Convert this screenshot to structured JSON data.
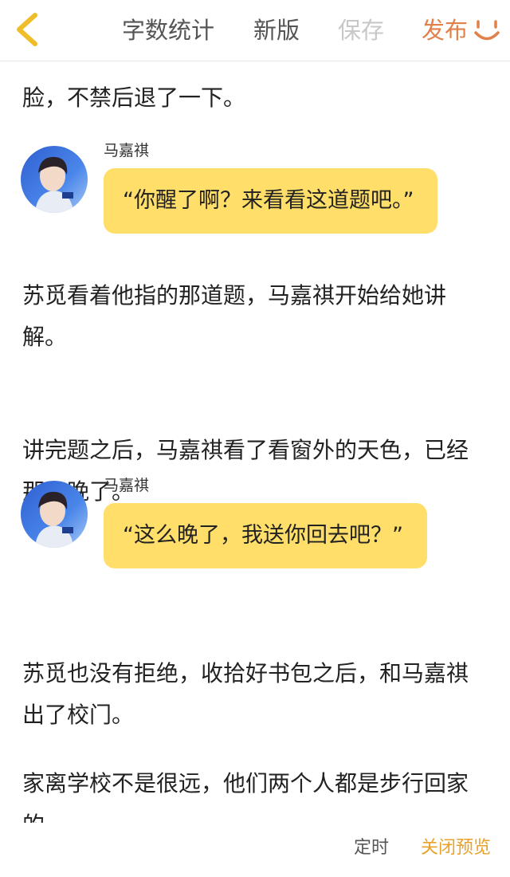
{
  "header": {
    "back_icon": "chevron-left-icon",
    "word_count": "字数统计",
    "new_version": "新版",
    "save": "保存",
    "publish": "发布",
    "emoji_icon": "smile-icon",
    "colors": {
      "accent_publish": "#e2804a",
      "disabled": "#c8c8c8"
    }
  },
  "story": {
    "cut_line": "脸，不禁后退了一下。",
    "messages": [
      {
        "speaker": "马嘉祺",
        "text": "“你醒了啊？来看看这道题吧。”"
      },
      {
        "speaker": "马嘉祺",
        "text": "“这么晚了，我送你回去吧？”"
      }
    ],
    "paragraphs": [
      "苏觅看着他指的那道题，马嘉祺开始给她讲解。",
      "讲完题之后，马嘉祺看了看窗外的天色，已经那么晚了。",
      "苏觅也没有拒绝，收拾好书包之后，和马嘉祺出了校门。",
      "家离学校不是很远，他们两个人都是步行回家的。"
    ],
    "bubble_color": "#ffde6a"
  },
  "bottom_bar": {
    "schedule": "定时",
    "close_preview": "关闭预览",
    "close_color": "#e9a229"
  }
}
